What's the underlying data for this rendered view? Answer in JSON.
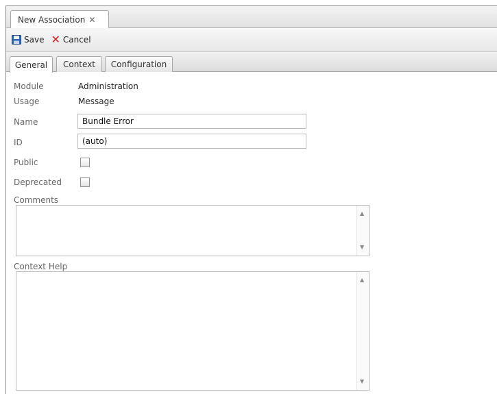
{
  "doc_tab": {
    "label": "New Association",
    "close_icon": "close-icon"
  },
  "toolbar": {
    "save_label": "Save",
    "save_icon": "save-disk-icon",
    "cancel_label": "Cancel",
    "cancel_icon": "cancel-x-icon",
    "cancel_color": "#d11c1c"
  },
  "tabs": [
    {
      "label": "General",
      "active": true
    },
    {
      "label": "Context",
      "active": false
    },
    {
      "label": "Configuration",
      "active": false
    }
  ],
  "form": {
    "module": {
      "label": "Module",
      "value": "Administration"
    },
    "usage": {
      "label": "Usage",
      "value": "Message"
    },
    "name": {
      "label": "Name",
      "value": "Bundle Error"
    },
    "id": {
      "label": "ID",
      "value": "(auto)"
    },
    "public": {
      "label": "Public",
      "checked": false
    },
    "deprecated": {
      "label": "Deprecated",
      "checked": false
    },
    "comments": {
      "label": "Comments",
      "value": ""
    },
    "context_help": {
      "label": "Context Help",
      "value": ""
    }
  }
}
